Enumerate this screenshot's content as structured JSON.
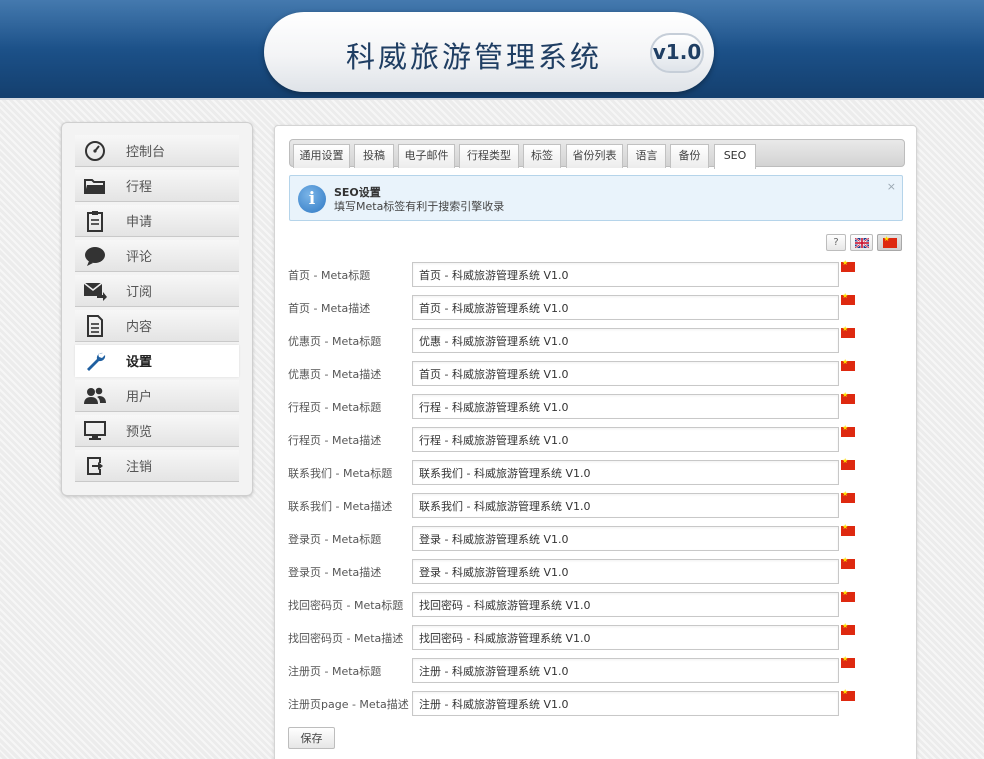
{
  "app": {
    "title": "科威旅游管理系统",
    "version": "v1.0"
  },
  "sidebar": {
    "items": [
      {
        "label": "控制台",
        "icon": "dashboard-icon"
      },
      {
        "label": "行程",
        "icon": "folder-icon"
      },
      {
        "label": "申请",
        "icon": "clipboard-icon"
      },
      {
        "label": "评论",
        "icon": "speech-bubble-icon"
      },
      {
        "label": "订阅",
        "icon": "mail-forward-icon"
      },
      {
        "label": "内容",
        "icon": "document-icon"
      },
      {
        "label": "设置",
        "icon": "wrench-icon",
        "active": true
      },
      {
        "label": "用户",
        "icon": "users-icon"
      },
      {
        "label": "预览",
        "icon": "monitor-icon"
      },
      {
        "label": "注销",
        "icon": "logout-icon"
      }
    ]
  },
  "tabs": [
    {
      "label": "通用设置"
    },
    {
      "label": "投稿"
    },
    {
      "label": "电子邮件"
    },
    {
      "label": "行程类型"
    },
    {
      "label": "标签"
    },
    {
      "label": "省份列表"
    },
    {
      "label": "语言"
    },
    {
      "label": "备份"
    },
    {
      "label": "SEO",
      "active": true
    }
  ],
  "alert": {
    "title": "SEO设置",
    "text": "填写Meta标签有利于搜索引擎收录",
    "close": "×",
    "icon": "info-icon"
  },
  "languages": [
    {
      "label": "?",
      "icon": "help-icon"
    },
    {
      "label": "",
      "icon": "uk-flag-icon"
    },
    {
      "label": "",
      "icon": "china-flag-icon",
      "active": true
    }
  ],
  "fields": [
    {
      "label": "首页 - Meta标题",
      "value": "首页 - 科威旅游管理系统 V1.0"
    },
    {
      "label": "首页 - Meta描述",
      "value": "首页 - 科威旅游管理系统 V1.0"
    },
    {
      "label": "优惠页 - Meta标题",
      "value": "优惠 - 科威旅游管理系统 V1.0"
    },
    {
      "label": "优惠页 - Meta描述",
      "value": "首页 - 科威旅游管理系统 V1.0"
    },
    {
      "label": "行程页 - Meta标题",
      "value": "行程 - 科威旅游管理系统 V1.0"
    },
    {
      "label": "行程页 - Meta描述",
      "value": "行程 - 科威旅游管理系统 V1.0"
    },
    {
      "label": "联系我们 - Meta标题",
      "value": "联系我们 - 科威旅游管理系统 V1.0"
    },
    {
      "label": "联系我们 - Meta描述",
      "value": "联系我们 - 科威旅游管理系统 V1.0"
    },
    {
      "label": "登录页 - Meta标题",
      "value": "登录 - 科威旅游管理系统 V1.0"
    },
    {
      "label": "登录页 - Meta描述",
      "value": "登录 - 科威旅游管理系统 V1.0"
    },
    {
      "label": "找回密码页 - Meta标题",
      "value": "找回密码 - 科威旅游管理系统 V1.0"
    },
    {
      "label": "找回密码页 - Meta描述",
      "value": "找回密码 - 科威旅游管理系统 V1.0"
    },
    {
      "label": "注册页 - Meta标题",
      "value": "注册 - 科威旅游管理系统 V1.0"
    },
    {
      "label": "注册页page - Meta描述",
      "value": "注册 - 科威旅游管理系统 V1.0"
    }
  ],
  "save_label": "保存",
  "colors": {
    "header": "#1b4f86",
    "title": "#1f3e63",
    "alert_bg": "#e9f3fb",
    "flag_red": "#de2910"
  }
}
